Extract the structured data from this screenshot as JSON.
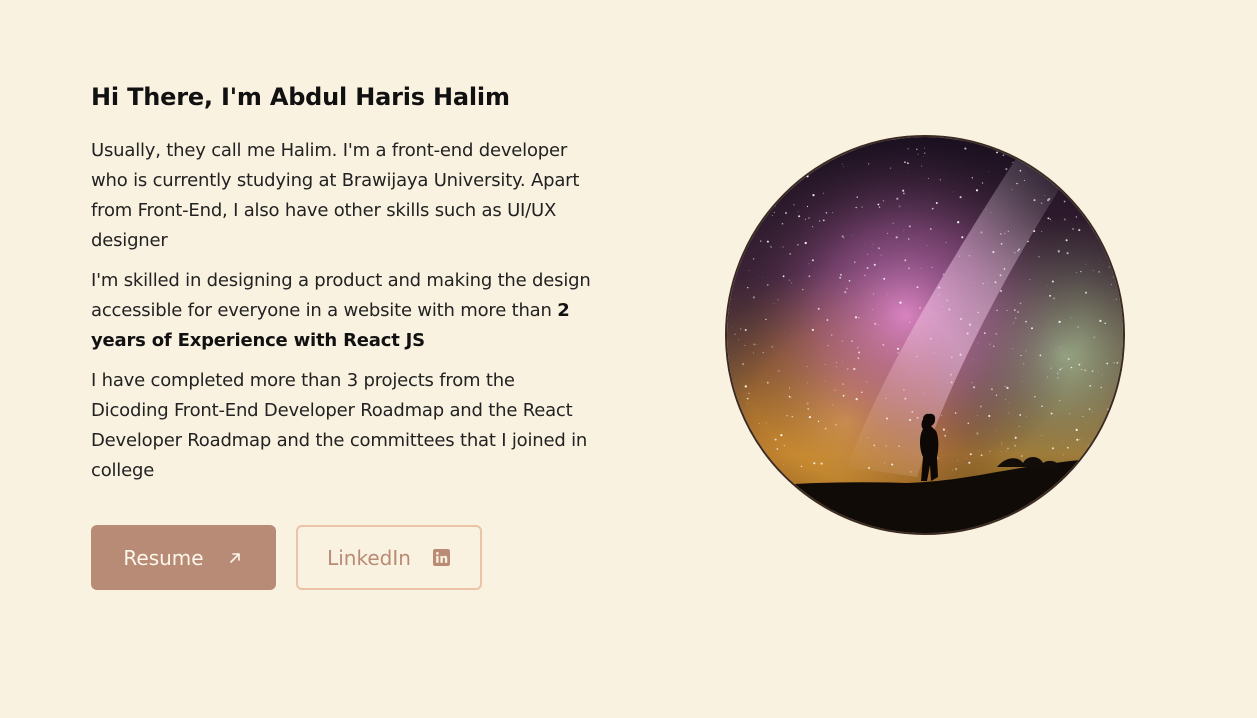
{
  "hero": {
    "title": "Hi There, I'm Abdul Haris Halim",
    "paragraph_1": "Usually, they call me Halim. I'm a front-end developer who is currently studying at Brawijaya University. Apart from Front-End, I also have other skills such as UI/UX designer",
    "paragraph_2_text": "I'm skilled in designing a product and making the design accessible for everyone in a website with more than",
    "paragraph_2_bold": "2 years of Experience with React JS",
    "paragraph_3": "I have completed more than 3 projects from the Dicoding Front-End Developer Roadmap and the React Developer Roadmap and the committees that I joined in college"
  },
  "buttons": {
    "resume_label": "Resume",
    "resume_icon": "arrow-up-right-icon",
    "linkedin_label": "LinkedIn",
    "linkedin_icon": "linkedin-icon"
  },
  "profile_image": {
    "subject": "silhouette-under-milky-way"
  },
  "colors": {
    "background": "#faf2e1",
    "resume_button": "#b78b75",
    "linkedin_border": "#ebc3a6",
    "linkedin_text": "#b98a74"
  }
}
